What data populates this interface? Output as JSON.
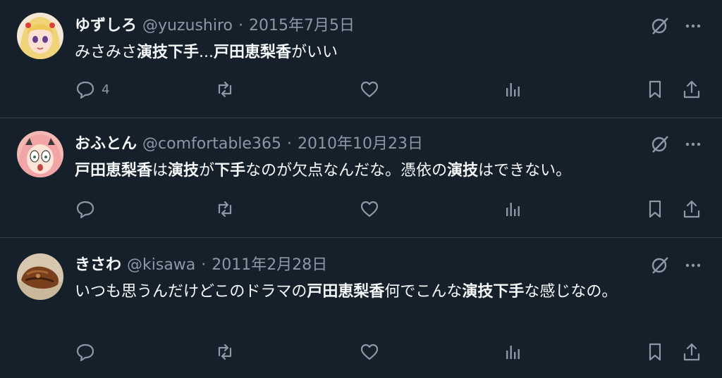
{
  "colors": {
    "background": "#15202b",
    "text": "#f7f9f9",
    "secondary": "#8b98a5",
    "divider": "#38444d"
  },
  "tweets": [
    {
      "name": "ゆずしろ",
      "handle": "@yuzushiro",
      "separator": "·",
      "date": "2015年7月5日",
      "avatar": "anime-girl-blonde-avatar",
      "text_parts": [
        {
          "t": "みさみさ",
          "bold": false
        },
        {
          "t": "演技下手",
          "bold": true
        },
        {
          "t": "...",
          "bold": false
        },
        {
          "t": "戸田恵梨香",
          "bold": true
        },
        {
          "t": "がいい",
          "bold": false
        }
      ],
      "reply_count": "4"
    },
    {
      "name": "おふとん",
      "handle": "@comfortable365",
      "separator": "·",
      "date": "2010年10月23日",
      "avatar": "anime-girl-pink-hair-avatar",
      "text_parts": [
        {
          "t": "戸田恵梨香",
          "bold": true
        },
        {
          "t": "は",
          "bold": false
        },
        {
          "t": "演技",
          "bold": true
        },
        {
          "t": "が",
          "bold": false
        },
        {
          "t": "下手",
          "bold": true
        },
        {
          "t": "なのが欠点なんだな。憑依の",
          "bold": false
        },
        {
          "t": "演技",
          "bold": true
        },
        {
          "t": "はできない。",
          "bold": false
        }
      ],
      "reply_count": ""
    },
    {
      "name": "きさわ",
      "handle": "@kisawa",
      "separator": "·",
      "date": "2011年2月28日",
      "avatar": "food-photo-avatar",
      "text_parts": [
        {
          "t": "いつも思うんだけどこのドラマの",
          "bold": false
        },
        {
          "t": "戸田恵梨香",
          "bold": true
        },
        {
          "t": "何でこんな",
          "bold": false
        },
        {
          "t": "演技下手",
          "bold": true
        },
        {
          "t": "な感じなの。",
          "bold": false
        }
      ],
      "reply_count": ""
    }
  ],
  "icons": {
    "grok": "grok-icon",
    "more": "more-icon",
    "reply": "reply-icon",
    "retweet": "retweet-icon",
    "like": "like-icon",
    "views": "views-icon",
    "bookmark": "bookmark-icon",
    "share": "share-icon"
  }
}
